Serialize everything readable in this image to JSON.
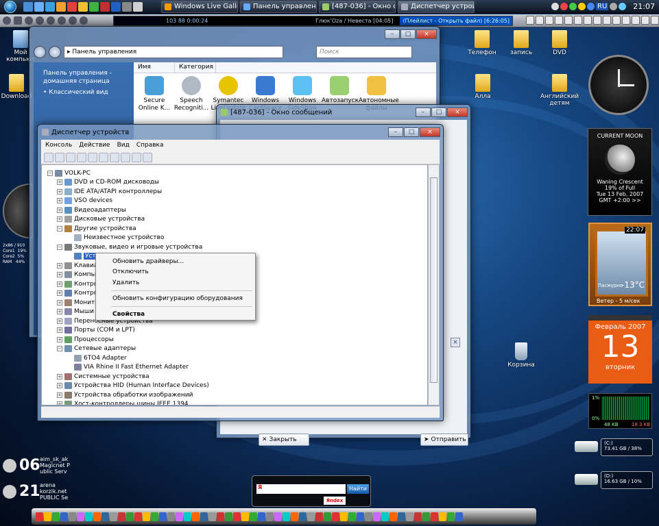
{
  "taskbar": {
    "windows": [
      {
        "label": "Windows Live Galler..."
      },
      {
        "label": "Панель управления"
      },
      {
        "label": "[487-036] - Окно со..."
      },
      {
        "label": "Диспетчер устройс..."
      }
    ],
    "tray": {
      "lang": "RU",
      "time": "21:07"
    }
  },
  "player": {
    "lcd": "103  88  0:00:24",
    "track": "Глюк'Oza / Невеста  [04:05]",
    "playlist": "(Плейлист - Открыть файл)  [6:26:05]"
  },
  "desktop_icons": [
    {
      "label": "Мой компьют"
    },
    {
      "label": "Download"
    },
    {
      "label": "Телефон"
    },
    {
      "label": "запись"
    },
    {
      "label": "DVD"
    },
    {
      "label": "Алла"
    },
    {
      "label": "Английский детям"
    },
    {
      "label": "Корзина"
    }
  ],
  "control_panel": {
    "address": "Панель управления",
    "search_placeholder": "Поиск",
    "sidebar_home": "Панель управления - домашняя страница",
    "sidebar_classic": "Классический вид",
    "col_name": "Имя",
    "col_category": "Категория",
    "icons": [
      {
        "label": "Secure Online K..."
      },
      {
        "label": "Speech Recogniti..."
      },
      {
        "label": "Symantec LiveUpdate"
      },
      {
        "label": "Windows CardSpace"
      },
      {
        "label": "Windows SideShow"
      },
      {
        "label": "Автозапуск"
      },
      {
        "label": "Автономные файлы"
      }
    ]
  },
  "message_window": {
    "title": "[487-036] - Окно сообщений",
    "close_label": "Закрыть",
    "send_label": "Отправить"
  },
  "device_manager": {
    "title": "Диспетчер устройств",
    "menu": [
      "Консоль",
      "Действие",
      "Вид",
      "Справка"
    ],
    "tree": [
      {
        "label": "VOLK-PC",
        "level": 0,
        "exp": "−"
      },
      {
        "label": "DVD и CD-ROM дисководы",
        "level": 1,
        "exp": "+"
      },
      {
        "label": "IDE ATA/ATAPI контроллеры",
        "level": 1,
        "exp": "+"
      },
      {
        "label": "VSO devices",
        "level": 1,
        "exp": "+"
      },
      {
        "label": "Видеоадаптеры",
        "level": 1,
        "exp": "+"
      },
      {
        "label": "Дисковые устройства",
        "level": 1,
        "exp": "+"
      },
      {
        "label": "Другие устройства",
        "level": 1,
        "exp": "−"
      },
      {
        "label": "Неизвестное устройство",
        "level": 2,
        "exp": ""
      },
      {
        "label": "Звуковые, видео и игровые устройства",
        "level": 1,
        "exp": "−"
      },
      {
        "label": "Устройство с поддержкой High Definition Audio",
        "level": 2,
        "exp": "",
        "selected": true
      },
      {
        "label": "Клавиатуры",
        "level": 1,
        "exp": "+"
      },
      {
        "label": "Компьютер",
        "level": 1,
        "exp": "+"
      },
      {
        "label": "Контроллеры IDE",
        "level": 1,
        "exp": "+"
      },
      {
        "label": "Контроллеры USB",
        "level": 1,
        "exp": "+"
      },
      {
        "label": "Мониторы",
        "level": 1,
        "exp": "+"
      },
      {
        "label": "Мыши и иные указывающие устройства",
        "level": 1,
        "exp": "+"
      },
      {
        "label": "Переносные устройства",
        "level": 1,
        "exp": "+"
      },
      {
        "label": "Порты (COM и LPT)",
        "level": 1,
        "exp": "+"
      },
      {
        "label": "Процессоры",
        "level": 1,
        "exp": "+"
      },
      {
        "label": "Сетевые адаптеры",
        "level": 1,
        "exp": "−"
      },
      {
        "label": "6TO4 Adapter",
        "level": 2,
        "exp": ""
      },
      {
        "label": "VIA Rhine II Fast Ethernet Adapter",
        "level": 2,
        "exp": ""
      },
      {
        "label": "Системные устройства",
        "level": 1,
        "exp": "+"
      },
      {
        "label": "Устройства HID (Human Interface Devices)",
        "level": 1,
        "exp": "+"
      },
      {
        "label": "Устройства обработки изображений",
        "level": 1,
        "exp": "+"
      },
      {
        "label": "Хост-контроллеры шины IEEE 1394",
        "level": 1,
        "exp": "+"
      }
    ]
  },
  "context_menu": {
    "update_drivers": "Обновить драйверы...",
    "disable": "Отключить",
    "uninstall": "Удалить",
    "scan": "Обновить конфигурацию оборудования",
    "properties": "Свойства"
  },
  "gadgets": {
    "moon_title": "CURRENT MOON",
    "moon_phase": "Waning Crescent",
    "moon_full": "19% of Full",
    "moon_date": "Tue 13 Feb, 2007",
    "moon_gmt": "GMT +2:00 >>",
    "weather_time": "22:07",
    "weather_cond": "Пасмурно",
    "weather_temp": "-13°C",
    "weather_wind": "Ветер - 5 м/сек",
    "cal_month": "Февраль 2007",
    "cal_day": "13",
    "cal_weekday": "вторник",
    "net_top": "1%",
    "net_bottom": "0%",
    "net_in": "48 KB",
    "net_out": "18.3 KB",
    "drive_c_label": "(C:)",
    "drive_c_info": "73.41 GB / 38%",
    "drive_d_label": "(D:)",
    "drive_d_info": "16.63 GB / 10%",
    "cpu_text": "2x86 / 910\nCore1  19%\nCore2  5%\nRAM   44%"
  },
  "game_widgets": [
    {
      "num": "06",
      "name": "aim_sk_ak",
      "line2": "Magicnet P",
      "line3": "ublic Serv"
    },
    {
      "num": "21",
      "name": "arena",
      "line2": "korzik.net",
      "line3": "PUBLIC Se"
    }
  ],
  "yandex": {
    "go": "Найти",
    "logo": "Яndex"
  },
  "colors": {
    "selection": "#3163c5",
    "calendar": "#ea5c14",
    "player_bg": "#000000"
  }
}
